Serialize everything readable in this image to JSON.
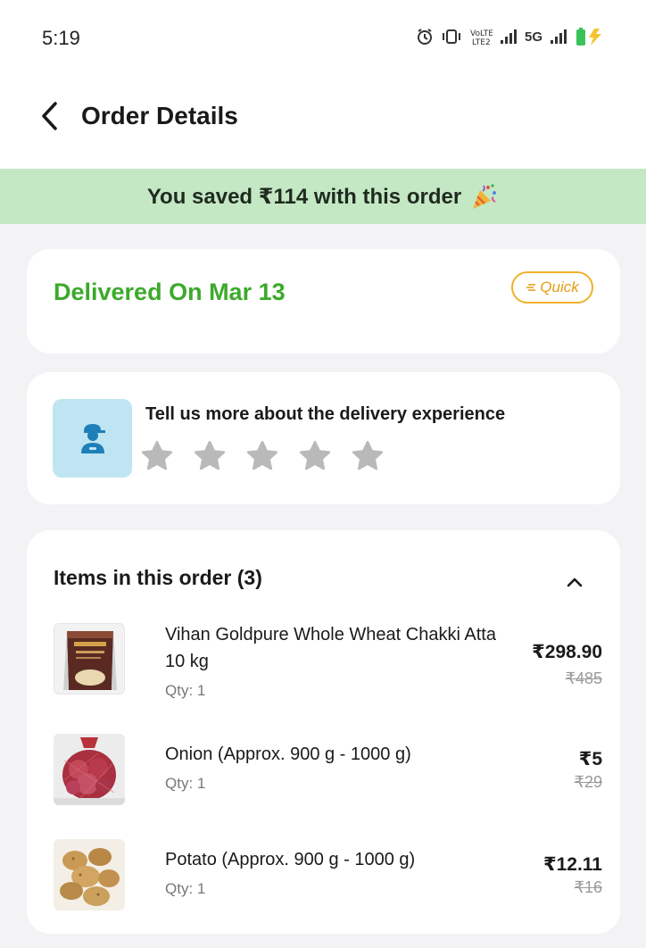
{
  "status_bar": {
    "time": "5:19",
    "network": "5G",
    "icons": [
      "alarm-icon",
      "vibrate-icon",
      "volte-icon",
      "signal-icon",
      "signal-icon",
      "battery-charging-icon"
    ]
  },
  "header": {
    "title": "Order Details",
    "back_icon": "chevron-left-icon"
  },
  "savings": {
    "text": "You saved ₹114 with this order",
    "icon": "party-popper-icon",
    "background": "#c4e8c4"
  },
  "order_status": {
    "text": "Delivered On Mar 13",
    "color": "#3caa2b",
    "badge": "Quick",
    "badge_color": "#f0b02b"
  },
  "feedback": {
    "prompt": "Tell us more about the delivery experience",
    "rating": 0,
    "max_rating": 5,
    "avatar_icon": "delivery-person-icon"
  },
  "items_section": {
    "title": "Items in this order (3)",
    "collapse_icon": "chevron-up-icon",
    "items": [
      {
        "name_line1": "Vihan Goldpure Whole Wheat Chakki Atta",
        "name_line2": "10 kg",
        "qty": "Qty: 1",
        "price": "₹298.90",
        "mrp": "₹485"
      },
      {
        "name_line1": "Onion (Approx. 900 g - 1000 g)",
        "qty": "Qty: 1",
        "price": "₹5",
        "mrp": "₹29"
      },
      {
        "name_line1": "Potato (Approx. 900 g - 1000 g)",
        "qty": "Qty: 1",
        "price": "₹12.11",
        "mrp": "₹16"
      }
    ]
  }
}
